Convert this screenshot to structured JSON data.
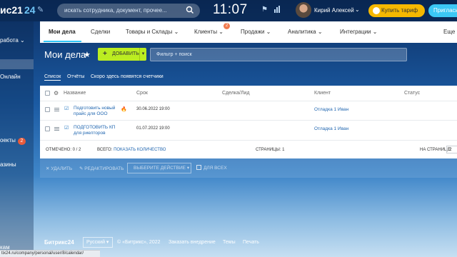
{
  "topbar": {
    "logo_text": "ис21",
    "logo_num": "24",
    "search_placeholder": "искать сотрудника, документ, прочее...",
    "clock": "11:07",
    "user_name": "Кирий Алексей",
    "buy_label": "Купить тариф",
    "invite_label": "Пригласить"
  },
  "sidebar": {
    "items": [
      {
        "label": "работа"
      },
      {
        "label": "Онлайн"
      },
      {
        "label": "оекты",
        "badge": "2"
      },
      {
        "label": "азины"
      },
      {
        "label": "кам"
      }
    ]
  },
  "tabs": {
    "items": [
      {
        "label": "Мои дела"
      },
      {
        "label": "Сделки"
      },
      {
        "label": "Товары и Склады"
      },
      {
        "label": "Клиенты",
        "badge": "2"
      },
      {
        "label": "Продажи"
      },
      {
        "label": "Аналитика"
      },
      {
        "label": "Интеграции"
      },
      {
        "label": "Еще"
      }
    ]
  },
  "page": {
    "title": "Мои дела",
    "add_label": "ДОБАВИТЬ",
    "filter_placeholder": "Фильтр + поиск"
  },
  "subtabs": {
    "list": "Список",
    "reports": "Отчёты",
    "soon": "Скоро здесь появятся счетчики"
  },
  "grid": {
    "headers": {
      "name": "Название",
      "deadline": "Срок",
      "deal": "Сделка/Лид",
      "client": "Клиент",
      "status": "Статус"
    },
    "rows": [
      {
        "title_line1": "Подготовить новый",
        "title_line2": "прайс для ООО",
        "deadline": "30.06.2022 19:00",
        "client": "Отладка 1 Иван"
      },
      {
        "title_line1": "ПОДГОТОВИТЬ КП",
        "title_line2": "для риелторов",
        "deadline": "01.07.2022 19:00",
        "client": "Отладка 1 Иван"
      }
    ],
    "footer": {
      "selected_label": "ОТМЕЧЕНО:",
      "selected_value": "0 / 2",
      "total_label": "ВСЕГО:",
      "total_link": "ПОКАЗАТЬ КОЛИЧЕСТВО",
      "pages_label": "СТРАНИЦЫ:",
      "pages_value": "1",
      "per_page_label": "НА СТРАНИЦЕ:",
      "per_page_value": "2"
    }
  },
  "actions": {
    "delete": "УДАЛИТЬ",
    "edit": "РЕДАКТИРОВАТЬ",
    "choose_action": "ВЫБЕРИТЕ ДЕЙСТВИЕ",
    "for_all": "ДЛЯ ВСЕХ"
  },
  "footer": {
    "logo": "Битрикс24",
    "language": "Русский",
    "copyright": "© «Битрикс», 2022",
    "order": "Заказать внедрение",
    "themes": "Темы",
    "print": "Печать",
    "status_url": "tix24.ru/company/personal/user/8/calendar/"
  }
}
